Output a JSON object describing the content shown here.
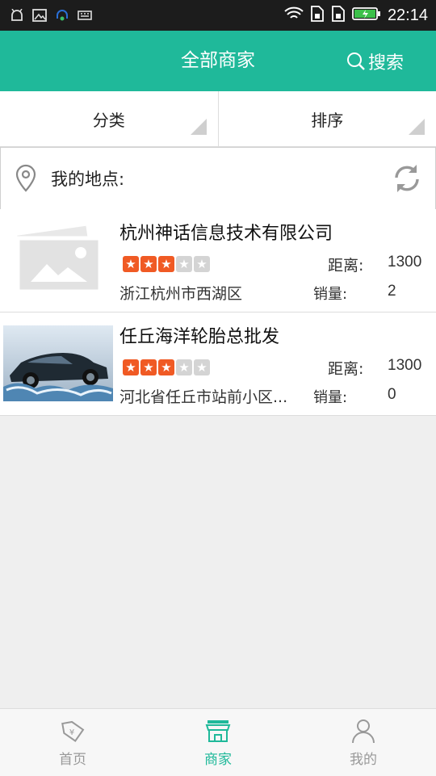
{
  "status_bar": {
    "time": "22:14",
    "left_icons": [
      "android-debug-icon",
      "image-icon",
      "headset-icon",
      "keyboard-icon"
    ],
    "right_icons": [
      "wifi-icon",
      "sim1-icon",
      "sim2-icon",
      "battery-charging-icon"
    ]
  },
  "header": {
    "title": "全部商家",
    "search_label": "搜索",
    "background": "#1fb99a"
  },
  "filters": {
    "category_label": "分类",
    "sort_label": "排序"
  },
  "location": {
    "label": "我的地点:"
  },
  "merchants": [
    {
      "name": "杭州神话信息技术有限公司",
      "rating": 3,
      "max_rating": 5,
      "distance_label": "距离:",
      "distance": "1300",
      "address": "浙江杭州市西湖区",
      "sales_label": "销量:",
      "sales": "2",
      "image": "placeholder-image-icon"
    },
    {
      "name": "任丘海洋轮胎总批发",
      "rating": 3,
      "max_rating": 5,
      "distance_label": "距离:",
      "distance": "1300",
      "address": "河北省任丘市站前小区...",
      "sales_label": "销量:",
      "sales": "0",
      "image": "car-photo"
    }
  ],
  "tabs": [
    {
      "label": "首页",
      "icon": "home-tag-icon",
      "active": false
    },
    {
      "label": "商家",
      "icon": "store-icon",
      "active": true
    },
    {
      "label": "我的",
      "icon": "person-icon",
      "active": false
    }
  ],
  "colors": {
    "accent": "#1fb99a",
    "star_on": "#f05a24",
    "star_off": "#d4d4d4"
  }
}
